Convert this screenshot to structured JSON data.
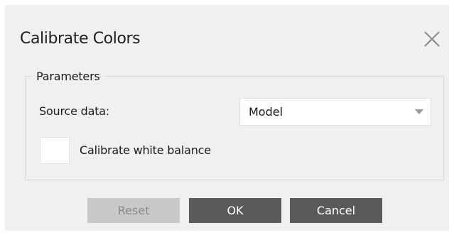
{
  "dialog": {
    "title": "Calibrate Colors",
    "close_icon": "close-icon"
  },
  "parameters": {
    "group_label": "Parameters",
    "source_data_label": "Source data:",
    "source_data_value": "Model",
    "dropdown_icon": "chevron-down-icon",
    "white_balance_label": "Calibrate white balance",
    "white_balance_checked": false
  },
  "buttons": {
    "reset_label": "Reset",
    "reset_enabled": false,
    "ok_label": "OK",
    "cancel_label": "Cancel"
  },
  "colors": {
    "dialog_background": "#f0f0f0",
    "primary_button": "#5a5a5a",
    "disabled_button": "#c8c8c8"
  }
}
